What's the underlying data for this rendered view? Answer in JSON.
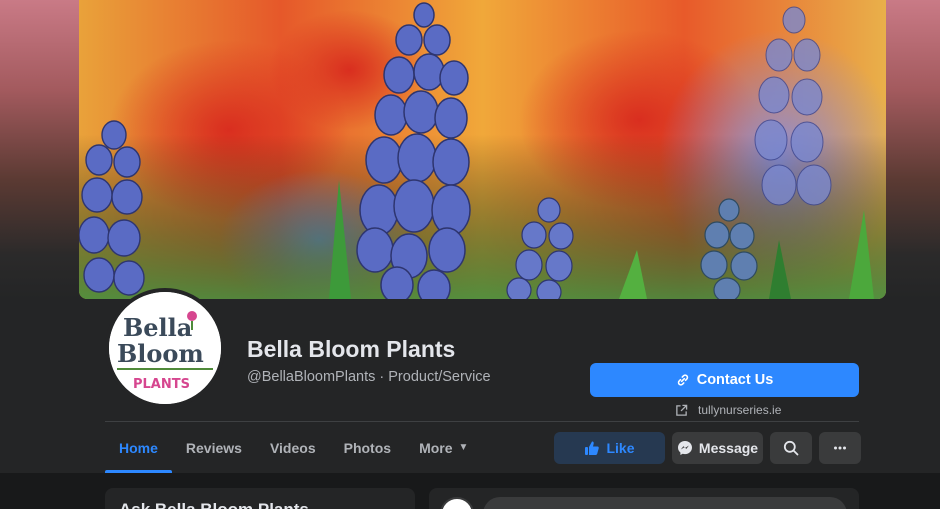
{
  "page": {
    "name": "Bella Bloom Plants",
    "handle": "@BellaBloomPlants",
    "separator": " · ",
    "category": "Product/Service"
  },
  "logo": {
    "line1": "Bella",
    "line2": "Bloom",
    "tagline": "PLANTS"
  },
  "contact_button": {
    "label": "Contact Us",
    "icon": "link-icon"
  },
  "website": {
    "label": "tullynurseries.ie",
    "icon": "external-link-icon"
  },
  "tabs": [
    {
      "label": "Home",
      "active": true
    },
    {
      "label": "Reviews"
    },
    {
      "label": "Videos"
    },
    {
      "label": "Photos"
    },
    {
      "label": "More",
      "icon": "caret-down-icon"
    }
  ],
  "actions": {
    "like": "Like",
    "message": "Message",
    "search_icon": "search-icon",
    "more_icon": "ellipsis-icon"
  },
  "feed": {
    "left_card_title": "Ask Bella Bloom Plants"
  },
  "colors": {
    "accent": "#2d88ff",
    "panel": "#242526",
    "background": "#18191a",
    "like_bg": "#263951",
    "logo_pink": "#d6468f",
    "logo_green": "#4f8a3a"
  }
}
